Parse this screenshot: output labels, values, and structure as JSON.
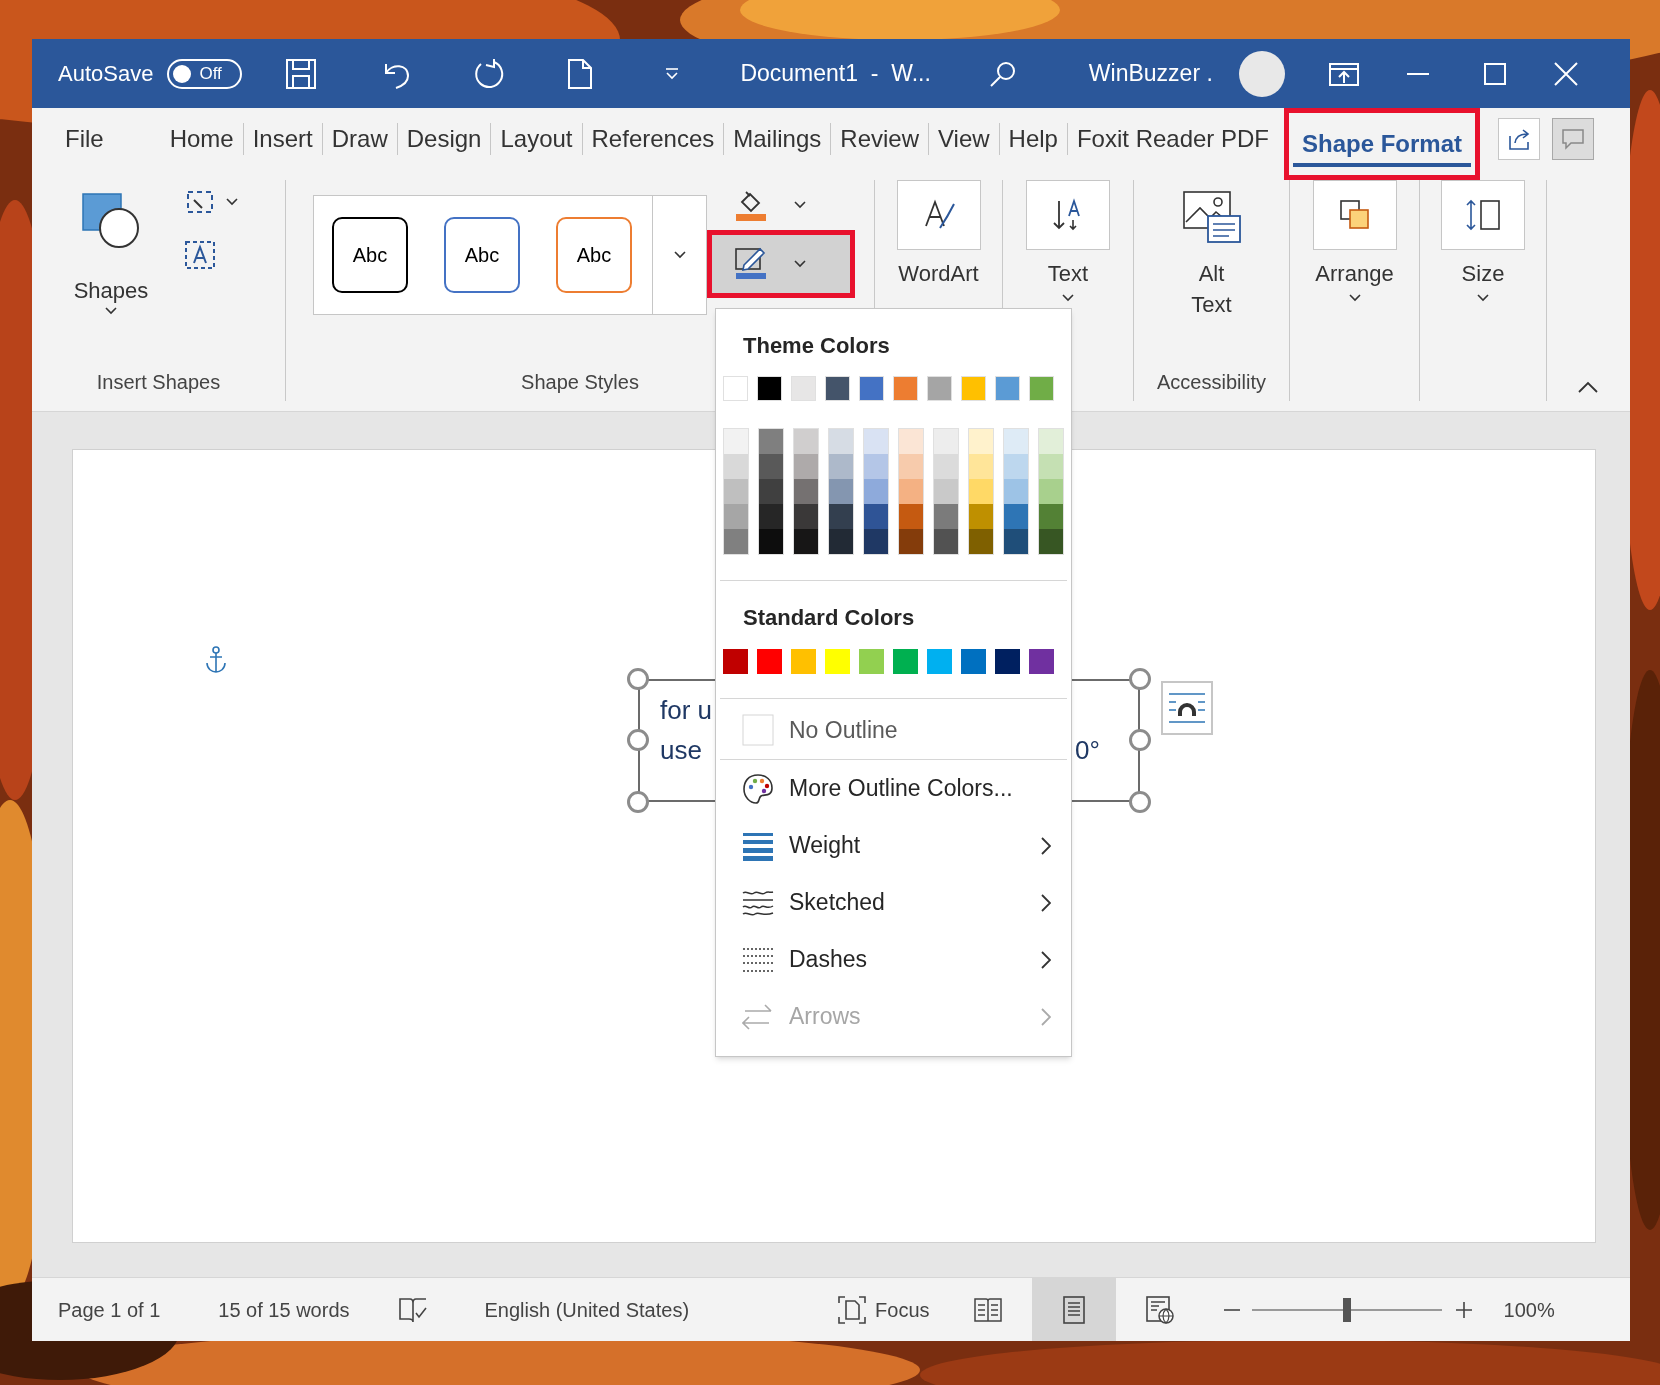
{
  "title_bar": {
    "autosave_label": "AutoSave",
    "autosave_toggle": {
      "label": "Off",
      "on": false
    },
    "document_title": "Document1  -  W...",
    "user_name": "WinBuzzer ."
  },
  "ribbon_tabs": [
    {
      "label": "File",
      "selected": false,
      "highlighted": false
    },
    {
      "label": "Home",
      "selected": false,
      "highlighted": false
    },
    {
      "label": "Insert",
      "selected": false,
      "highlighted": false
    },
    {
      "label": "Draw",
      "selected": false,
      "highlighted": false
    },
    {
      "label": "Design",
      "selected": false,
      "highlighted": false
    },
    {
      "label": "Layout",
      "selected": false,
      "highlighted": false
    },
    {
      "label": "References",
      "selected": false,
      "highlighted": false
    },
    {
      "label": "Mailings",
      "selected": false,
      "highlighted": false
    },
    {
      "label": "Review",
      "selected": false,
      "highlighted": false
    },
    {
      "label": "View",
      "selected": false,
      "highlighted": false
    },
    {
      "label": "Help",
      "selected": false,
      "highlighted": false
    },
    {
      "label": "Foxit Reader PDF",
      "selected": false,
      "highlighted": false
    },
    {
      "label": "Shape Format",
      "selected": true,
      "highlighted": true
    }
  ],
  "ribbon": {
    "insert_shapes": {
      "shapes_label": "Shapes",
      "group_label": "Insert Shapes"
    },
    "shape_styles": {
      "presets": [
        {
          "label": "Abc",
          "color": "#000000"
        },
        {
          "label": "Abc",
          "color": "#4472c4"
        },
        {
          "label": "Abc",
          "color": "#ed7d31"
        }
      ],
      "fill_button": {
        "pressed": false,
        "highlighted": false
      },
      "outline_button": {
        "pressed": true,
        "highlighted": true
      },
      "group_label": "Shape Styles"
    },
    "wordart": {
      "label": "WordArt"
    },
    "text": {
      "label": "Text"
    },
    "accessibility": {
      "label": "Alt Text",
      "group_label": "Accessibility"
    },
    "arrange": {
      "label": "Arrange"
    },
    "size": {
      "label": "Size"
    }
  },
  "outline_menu": {
    "theme_heading": "Theme Colors",
    "theme_colors": [
      {
        "color": "#ffffff"
      },
      {
        "color": "#000000"
      },
      {
        "color": "#e7e6e6"
      },
      {
        "color": "#44546a"
      },
      {
        "color": "#4472c4"
      },
      {
        "color": "#ed7d31"
      },
      {
        "color": "#a5a5a5"
      },
      {
        "color": "#ffc000"
      },
      {
        "color": "#5b9bd5"
      },
      {
        "color": "#70ad47"
      }
    ],
    "theme_shades": [
      {
        "swatches": [
          {
            "color": "#f2f2f2"
          },
          {
            "color": "#d9d9d9"
          },
          {
            "color": "#bfbfbf"
          },
          {
            "color": "#a6a6a6"
          },
          {
            "color": "#808080"
          }
        ]
      },
      {
        "swatches": [
          {
            "color": "#7f7f7f"
          },
          {
            "color": "#595959"
          },
          {
            "color": "#404040"
          },
          {
            "color": "#262626"
          },
          {
            "color": "#0d0d0d"
          }
        ]
      },
      {
        "swatches": [
          {
            "color": "#d0cece"
          },
          {
            "color": "#aeaaaa"
          },
          {
            "color": "#757171"
          },
          {
            "color": "#3a3838"
          },
          {
            "color": "#171616"
          }
        ]
      },
      {
        "swatches": [
          {
            "color": "#d6dce4"
          },
          {
            "color": "#adb9ca"
          },
          {
            "color": "#8496b0"
          },
          {
            "color": "#333f4f"
          },
          {
            "color": "#222a35"
          }
        ]
      },
      {
        "swatches": [
          {
            "color": "#d9e2f3"
          },
          {
            "color": "#b4c6e7"
          },
          {
            "color": "#8eaadb"
          },
          {
            "color": "#2f5496"
          },
          {
            "color": "#1f3864"
          }
        ]
      },
      {
        "swatches": [
          {
            "color": "#fbe5d5"
          },
          {
            "color": "#f7cbac"
          },
          {
            "color": "#f4b183"
          },
          {
            "color": "#c55a11"
          },
          {
            "color": "#843c0b"
          }
        ]
      },
      {
        "swatches": [
          {
            "color": "#ededed"
          },
          {
            "color": "#dbdbdb"
          },
          {
            "color": "#c9c9c9"
          },
          {
            "color": "#7b7b7b"
          },
          {
            "color": "#525252"
          }
        ]
      },
      {
        "swatches": [
          {
            "color": "#fff2cc"
          },
          {
            "color": "#ffe599"
          },
          {
            "color": "#ffd966"
          },
          {
            "color": "#bf9000"
          },
          {
            "color": "#7f6000"
          }
        ]
      },
      {
        "swatches": [
          {
            "color": "#deebf6"
          },
          {
            "color": "#bdd7ee"
          },
          {
            "color": "#9dc3e6"
          },
          {
            "color": "#2e75b5"
          },
          {
            "color": "#1f4e79"
          }
        ]
      },
      {
        "swatches": [
          {
            "color": "#e2efd9"
          },
          {
            "color": "#c5e0b3"
          },
          {
            "color": "#a8d08d"
          },
          {
            "color": "#538135"
          },
          {
            "color": "#375623"
          }
        ]
      }
    ],
    "standard_heading": "Standard Colors",
    "standard_colors": [
      {
        "color": "#c00000"
      },
      {
        "color": "#ff0000"
      },
      {
        "color": "#ffc000"
      },
      {
        "color": "#ffff00"
      },
      {
        "color": "#92d050"
      },
      {
        "color": "#00b050"
      },
      {
        "color": "#00b0f0"
      },
      {
        "color": "#0070c0"
      },
      {
        "color": "#002060"
      },
      {
        "color": "#7030a0"
      }
    ],
    "items": [
      {
        "kind": "no_outline",
        "label": "No Outline",
        "submenu": false,
        "disabled": false
      },
      {
        "kind": "more_colors",
        "label": "More Outline Colors...",
        "submenu": false,
        "disabled": false
      },
      {
        "kind": "weight",
        "label": "Weight",
        "submenu": true,
        "disabled": false
      },
      {
        "kind": "sketched",
        "label": "Sketched",
        "submenu": true,
        "disabled": false
      },
      {
        "kind": "dashes",
        "label": "Dashes",
        "submenu": true,
        "disabled": false
      },
      {
        "kind": "arrows",
        "label": "Arrows",
        "submenu": true,
        "disabled": true
      }
    ]
  },
  "document": {
    "text_box": {
      "line_1_start": "for u",
      "line_2_start": "use",
      "line_2_end": "0°"
    }
  },
  "status_bar": {
    "page": "Page 1 of 1",
    "words": "15 of 15 words",
    "language": "English (United States)",
    "focus": "Focus",
    "views": [
      {
        "kind": "read",
        "selected": false
      },
      {
        "kind": "print",
        "selected": true
      },
      {
        "kind": "web",
        "selected": false
      }
    ],
    "zoom": {
      "level": 0.5,
      "percent": "100%"
    }
  }
}
